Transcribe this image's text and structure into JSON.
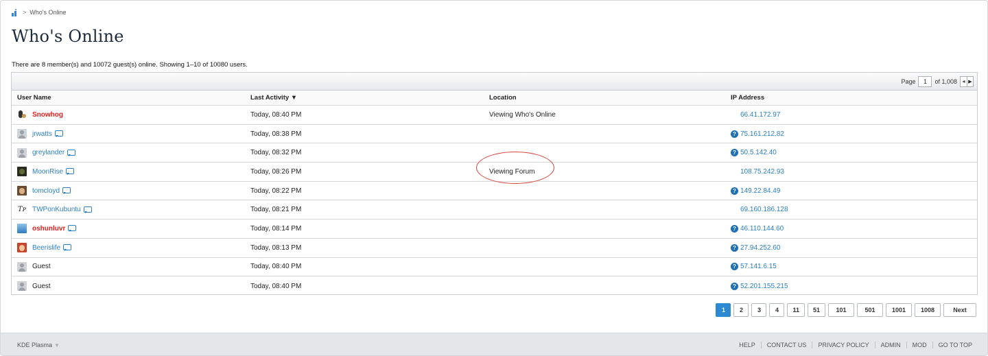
{
  "breadcrumb": {
    "separator": ">",
    "current": "Who's Online"
  },
  "page": {
    "title": "Who's Online",
    "summary": "There are 8 member(s) and 10072 guest(s) online. Showing 1–10 of 10080 users."
  },
  "pager": {
    "label": "Page",
    "current": "1",
    "total_label": "of 1,008",
    "prev": "◄",
    "next": "▶"
  },
  "table": {
    "headers": {
      "user": "User Name",
      "activity": "Last Activity ▼",
      "location": "Location",
      "ip": "IP Address"
    },
    "rows": [
      {
        "name": "Snowhog",
        "style": "bold-red",
        "avatar": "snowhog",
        "pm": false,
        "activity": "Today, 08:40 PM",
        "location": "Viewing Who's Online",
        "ip": "66.41.172.97",
        "ip_icon": false
      },
      {
        "name": "jrwatts",
        "style": "link",
        "avatar": "default",
        "pm": true,
        "activity": "Today, 08:38 PM",
        "location": "",
        "ip": "75.161.212.82",
        "ip_icon": true
      },
      {
        "name": "greylander",
        "style": "link",
        "avatar": "default",
        "pm": true,
        "activity": "Today, 08:32 PM",
        "location": "",
        "ip": "50.5.142.40",
        "ip_icon": true
      },
      {
        "name": "MoonRise",
        "style": "link",
        "avatar": "moonrise",
        "pm": true,
        "activity": "Today, 08:26 PM",
        "location": "Viewing Forum",
        "ip": "108.75.242.93",
        "ip_icon": false
      },
      {
        "name": "tomcloyd",
        "style": "link",
        "avatar": "tomcloyd",
        "pm": true,
        "activity": "Today, 08:22 PM",
        "location": "",
        "ip": "149.22.84.49",
        "ip_icon": true
      },
      {
        "name": "TWPonKubuntu",
        "style": "link",
        "avatar": "twp",
        "pm": true,
        "activity": "Today, 08:21 PM",
        "location": "",
        "ip": "69.160.186.128",
        "ip_icon": false
      },
      {
        "name": "oshunluvr",
        "style": "bold-red",
        "avatar": "oshun",
        "pm": true,
        "activity": "Today, 08:14 PM",
        "location": "",
        "ip": "46.110.144.60",
        "ip_icon": true
      },
      {
        "name": "Beerislife",
        "style": "link",
        "avatar": "beer",
        "pm": true,
        "activity": "Today, 08:13 PM",
        "location": "",
        "ip": "27.94.252.60",
        "ip_icon": true
      },
      {
        "name": "Guest",
        "style": "guest",
        "avatar": "default",
        "pm": false,
        "activity": "Today, 08:40 PM",
        "location": "",
        "ip": "57.141.6.15",
        "ip_icon": true
      },
      {
        "name": "Guest",
        "style": "guest",
        "avatar": "default",
        "pm": false,
        "activity": "Today, 08:40 PM",
        "location": "",
        "ip": "52.201.155.215",
        "ip_icon": true
      }
    ]
  },
  "pagination": [
    "1",
    "2",
    "3",
    "4",
    "11",
    "51",
    "101",
    "501",
    "1001",
    "1008",
    "Next"
  ],
  "footer": {
    "style_name": "KDE Plasma",
    "caret": "▼",
    "links": [
      "HELP",
      "CONTACT US",
      "PRIVACY POLICY",
      "ADMIN",
      "MOD",
      "GO TO TOP"
    ]
  },
  "colors": {
    "accent": "#2b8ad1",
    "link": "#2b7fc4",
    "admin_name": "#e01e1e",
    "annotation": "#d9433a"
  }
}
